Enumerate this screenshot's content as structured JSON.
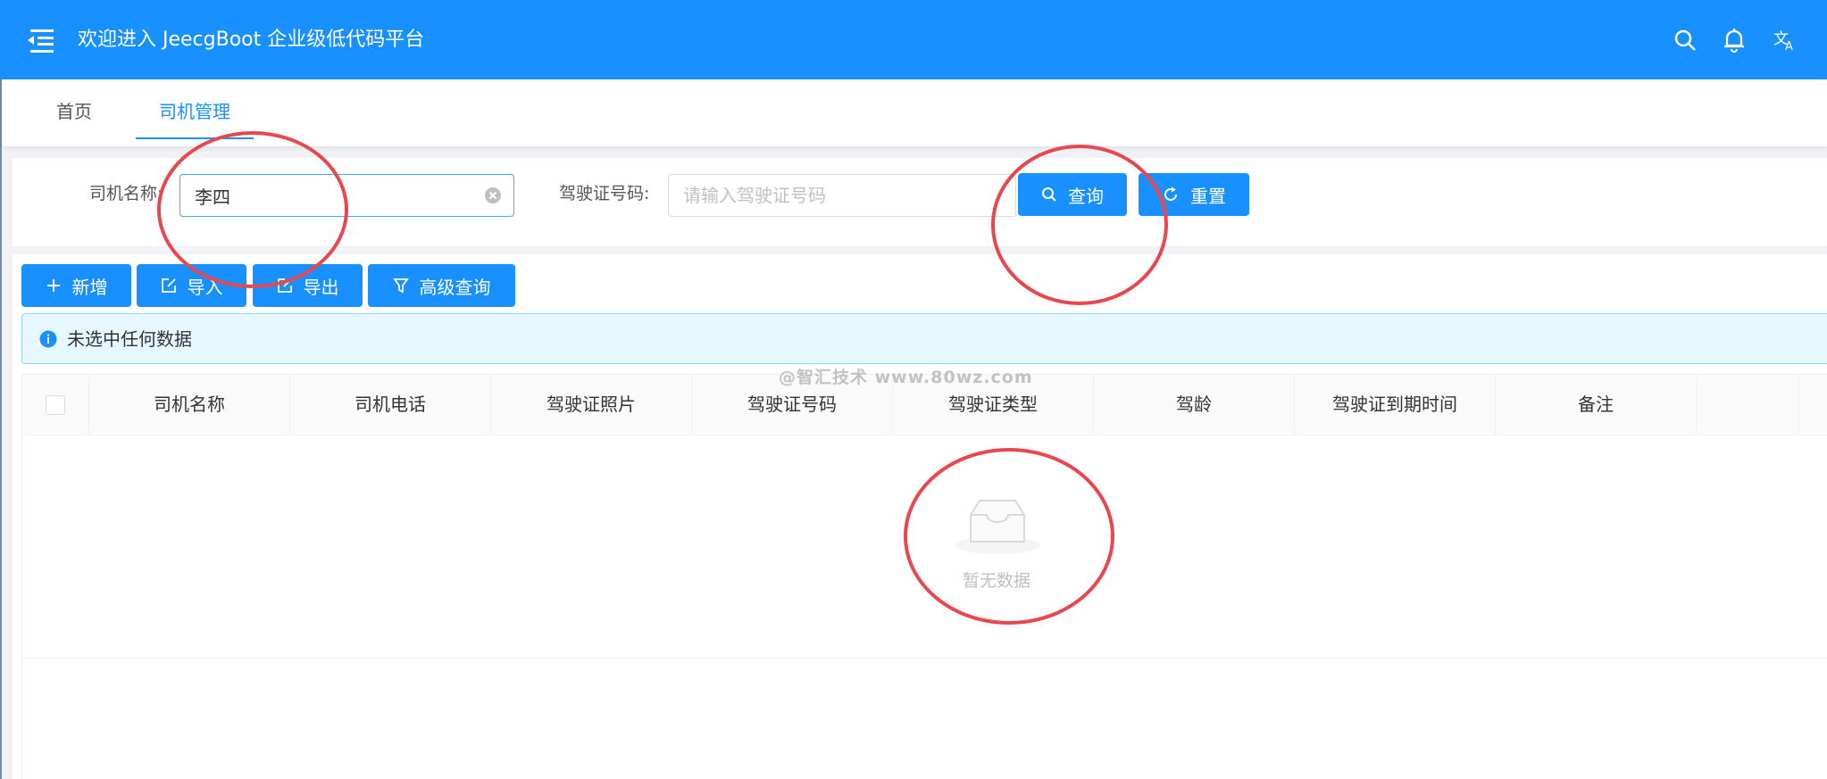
{
  "header": {
    "title": "欢迎进入 JeecgBoot 企业级低代码平台",
    "icons": [
      "menu-fold-icon",
      "search-icon",
      "bell-icon",
      "translate-icon"
    ]
  },
  "tabs": [
    {
      "label": "首页",
      "active": false
    },
    {
      "label": "司机管理",
      "active": true
    }
  ],
  "search": {
    "driver_name_label": "司机名称:",
    "driver_name_value": "李四",
    "license_no_label": "驾驶证号码:",
    "license_no_placeholder": "请输入驾驶证号码",
    "query_label": "查询",
    "reset_label": "重置"
  },
  "toolbar": {
    "add_label": "新增",
    "import_label": "导入",
    "export_label": "导出",
    "advanced_label": "高级查询"
  },
  "alert": {
    "text": "未选中任何数据"
  },
  "table": {
    "columns": [
      "司机名称",
      "司机电话",
      "驾驶证照片",
      "驾驶证号码",
      "驾驶证类型",
      "驾龄",
      "驾驶证到期时间",
      "备注"
    ],
    "empty_text": "暂无数据"
  },
  "watermark": "@智汇技术 www.80wz.com",
  "colors": {
    "primary": "#1890ff",
    "annotation": "#e8474f",
    "alert_bg": "#e6f7ff"
  }
}
